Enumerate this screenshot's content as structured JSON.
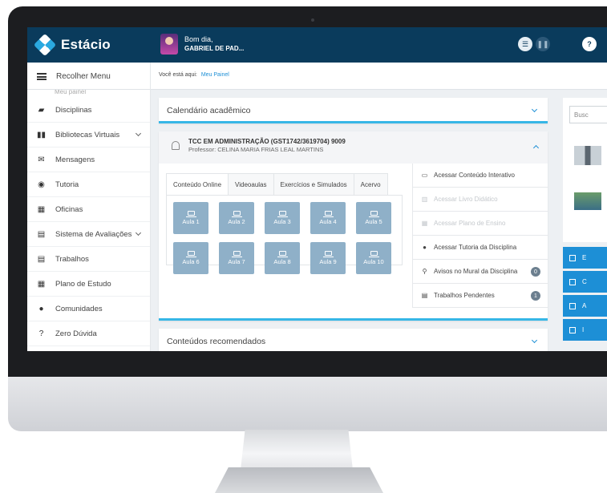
{
  "header": {
    "brand": "Estácio",
    "greeting": "Bom dia,",
    "user_name": "GABRIEL DE PAD...",
    "btn_menu": "☰",
    "btn_pause": "❚❚",
    "btn_help": "?"
  },
  "toolbar": {
    "collapse_menu": "Recolher Menu",
    "breadcrumb_prefix": "Você está aqui:",
    "breadcrumb_link": "Meu Painel"
  },
  "sidebar": {
    "cut_item": "Meu painel",
    "items": [
      {
        "label": "Disciplinas",
        "icon": "book-icon",
        "glyph": "▰"
      },
      {
        "label": "Bibliotecas Virtuais",
        "icon": "books-icon",
        "glyph": "▮▮",
        "expand": true
      },
      {
        "label": "Mensagens",
        "icon": "envelope-icon",
        "glyph": "✉"
      },
      {
        "label": "Tutoria",
        "icon": "user-circle-icon",
        "glyph": "◉"
      },
      {
        "label": "Oficinas",
        "icon": "grid-icon",
        "glyph": "▦"
      },
      {
        "label": "Sistema de Avaliações",
        "icon": "document-icon",
        "glyph": "▤",
        "expand": true
      },
      {
        "label": "Trabalhos",
        "icon": "file-icon",
        "glyph": "▤"
      },
      {
        "label": "Plano de Estudo",
        "icon": "calendar-icon",
        "glyph": "▦"
      },
      {
        "label": "Comunidades",
        "icon": "chat-icon",
        "glyph": "●"
      },
      {
        "label": "Zero Dúvida",
        "icon": "question-icon",
        "glyph": "?"
      }
    ]
  },
  "calendar": {
    "title": "Calendário acadêmico"
  },
  "course": {
    "name": "TCC EM ADMINISTRAÇÃO (GST1742/3619704) 9009",
    "professor": "Professor: CELINA MARIA FRIAS LEAL MARTINS",
    "tabs": [
      "Conteúdo Online",
      "Videoaulas",
      "Exercícios e Simulados",
      "Acervo"
    ],
    "lessons": [
      "Aula 1",
      "Aula 2",
      "Aula 3",
      "Aula 4",
      "Aula 5",
      "Aula 6",
      "Aula 7",
      "Aula 8",
      "Aula 9",
      "Aula 10"
    ],
    "actions": [
      {
        "label": "Acessar Conteúdo Interativo",
        "glyph": "▭",
        "enabled": true
      },
      {
        "label": "Acessar Livro Didático",
        "glyph": "▥",
        "enabled": false
      },
      {
        "label": "Acessar Plano de Ensino",
        "glyph": "▦",
        "enabled": false
      },
      {
        "label": "Acessar Tutoria da Disciplina",
        "glyph": "●",
        "enabled": true
      },
      {
        "label": "Avisos no Mural da Disciplina",
        "glyph": "⚲",
        "enabled": true,
        "badge": "0"
      },
      {
        "label": "Trabalhos Pendentes",
        "glyph": "▤",
        "enabled": true,
        "badge": "1"
      }
    ]
  },
  "recommended": {
    "title": "Conteúdos recomendados"
  },
  "right": {
    "search_placeholder": "Busc",
    "blue_labels": [
      "E",
      "C",
      "A",
      "I"
    ]
  }
}
